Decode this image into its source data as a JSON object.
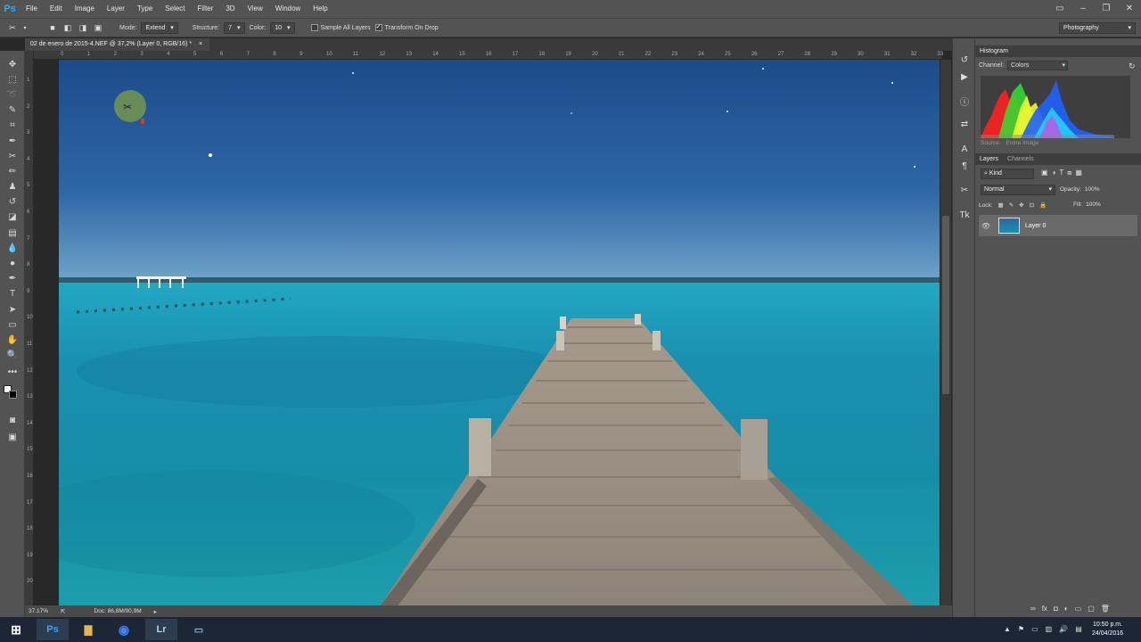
{
  "app": {
    "logo": "Ps",
    "brand_color": "#31a8ff"
  },
  "menu": [
    "File",
    "Edit",
    "Image",
    "Layer",
    "Type",
    "Select",
    "Filter",
    "3D",
    "View",
    "Window",
    "Help"
  ],
  "options": {
    "mode_label": "Mode:",
    "mode_value": "Extend",
    "structure_label": "Structure:",
    "structure_value": "7",
    "color_label": "Color:",
    "color_value": "10",
    "sample_all_layers": "Sample All Layers",
    "transform_on_drop": "Transform On Drop",
    "workspace": "Photography"
  },
  "document": {
    "tab_title": "02 de enero de 2015-4.NEF @ 37,2% (Layer 0, RGB/16) *",
    "close": "×"
  },
  "ruler_top": [
    "0",
    "1",
    "2",
    "3",
    "4",
    "5",
    "6",
    "7",
    "8",
    "9",
    "10",
    "11",
    "12",
    "13",
    "14",
    "15",
    "16",
    "17",
    "18",
    "19",
    "20",
    "21",
    "22",
    "23",
    "24",
    "25",
    "26",
    "27",
    "28",
    "29",
    "30",
    "31",
    "32",
    "33"
  ],
  "ruler_left": [
    "1",
    "2",
    "3",
    "4",
    "5",
    "6",
    "7",
    "8",
    "9",
    "10",
    "11",
    "12",
    "13",
    "14",
    "15",
    "16",
    "17",
    "18",
    "19",
    "20"
  ],
  "status": {
    "zoom": "37.17%",
    "doc": "Doc: 86,8M/90,9M"
  },
  "histogram": {
    "title": "Histogram",
    "channel_label": "Channel:",
    "channel_value": "Colors",
    "source_label": "Source:",
    "source_value": "Entire Image",
    "warning": "⚠"
  },
  "layers": {
    "tabs": [
      "Layers",
      "Channels"
    ],
    "kind_label": "Kind",
    "blend_mode": "Normal",
    "opacity_label": "Opacity:",
    "opacity_value": "100%",
    "lock_label": "Lock:",
    "fill_label": "Fill:",
    "fill_value": "100%",
    "layer_name": "Layer 0",
    "bottom_icons": [
      "fx",
      "◘",
      "◐",
      "▭",
      "▢",
      "🗑"
    ]
  },
  "taskbar": {
    "time": "10:50 p.m.",
    "date": "24/04/2016",
    "apps": [
      {
        "name": "photoshop-app",
        "label": "Ps",
        "color": "#31a8ff"
      },
      {
        "name": "explorer-app",
        "label": "",
        "color": "#e7b645"
      },
      {
        "name": "chrome-app",
        "label": "",
        "color": "#4285f4"
      },
      {
        "name": "lightroom-app",
        "label": "Lr",
        "color": "#add5ec"
      },
      {
        "name": "screen-app",
        "label": "",
        "color": "#7fb0d8"
      }
    ]
  }
}
